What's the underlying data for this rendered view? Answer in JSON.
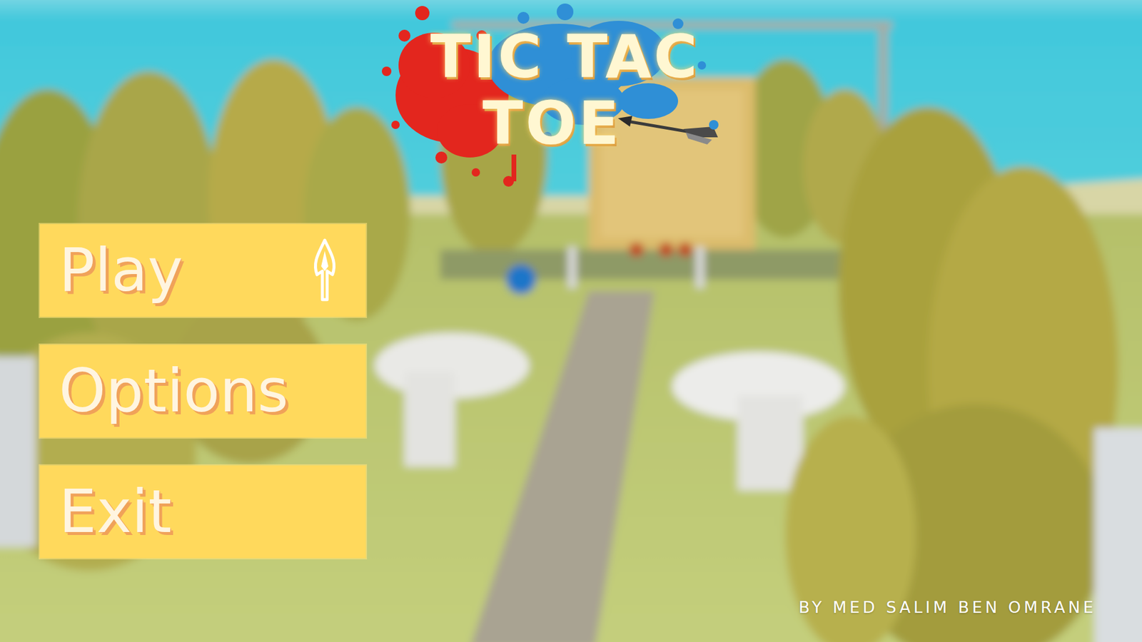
{
  "title": {
    "lines": [
      "TIC TAC",
      "TOE"
    ]
  },
  "menu": [
    {
      "label": "Play",
      "selected": true
    },
    {
      "label": "Options",
      "selected": false
    },
    {
      "label": "Exit",
      "selected": false
    }
  ],
  "credit": "BY MED SALIM BEN OMRANE"
}
